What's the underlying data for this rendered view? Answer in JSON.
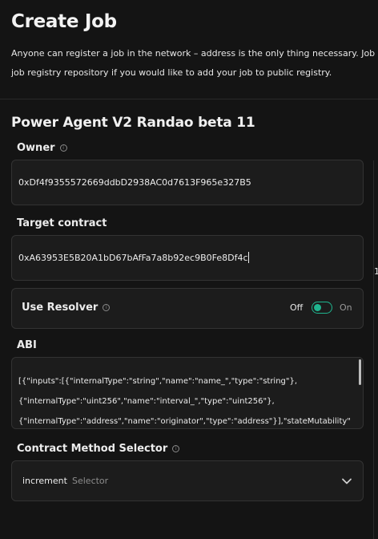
{
  "header": {
    "title": "Create Job",
    "description_line1": "Anyone can register a job in the network – address is the only thing necessary. Job owner",
    "description_line2": "job registry repository if you would like to add your job to public registry."
  },
  "job": {
    "title": "Power Agent V2 Randao beta 11"
  },
  "owner": {
    "label": "Owner",
    "value": "0xDf4f9355572669ddbD2938AC0d7613F965e327B5"
  },
  "target_contract": {
    "label": "Target contract",
    "value": "0xA63953E5B20A1bD67bAfFa7a8b92ec9B0Fe8Df4c"
  },
  "resolver": {
    "label": "Use Resolver",
    "off_label": "Off",
    "on_label": "On",
    "enabled": false
  },
  "abi": {
    "label": "ABI",
    "line1": "[{\"inputs\":[{\"internalType\":\"string\",\"name\":\"name_\",\"type\":\"string\"},",
    "line2": "{\"internalType\":\"uint256\",\"name\":\"interval_\",\"type\":\"uint256\"},",
    "line3": "{\"internalType\":\"address\",\"name\":\"originator\",\"type\":\"address\"}],\"stateMutability\""
  },
  "method_selector": {
    "label": "Contract Method Selector",
    "value": "increment",
    "placeholder": "Selector"
  },
  "right_panel": {
    "fragment": "1"
  },
  "colors": {
    "background": "#141414",
    "field_bg": "#1c1c1c",
    "field_border": "#333333",
    "accent": "#1fb58f"
  }
}
